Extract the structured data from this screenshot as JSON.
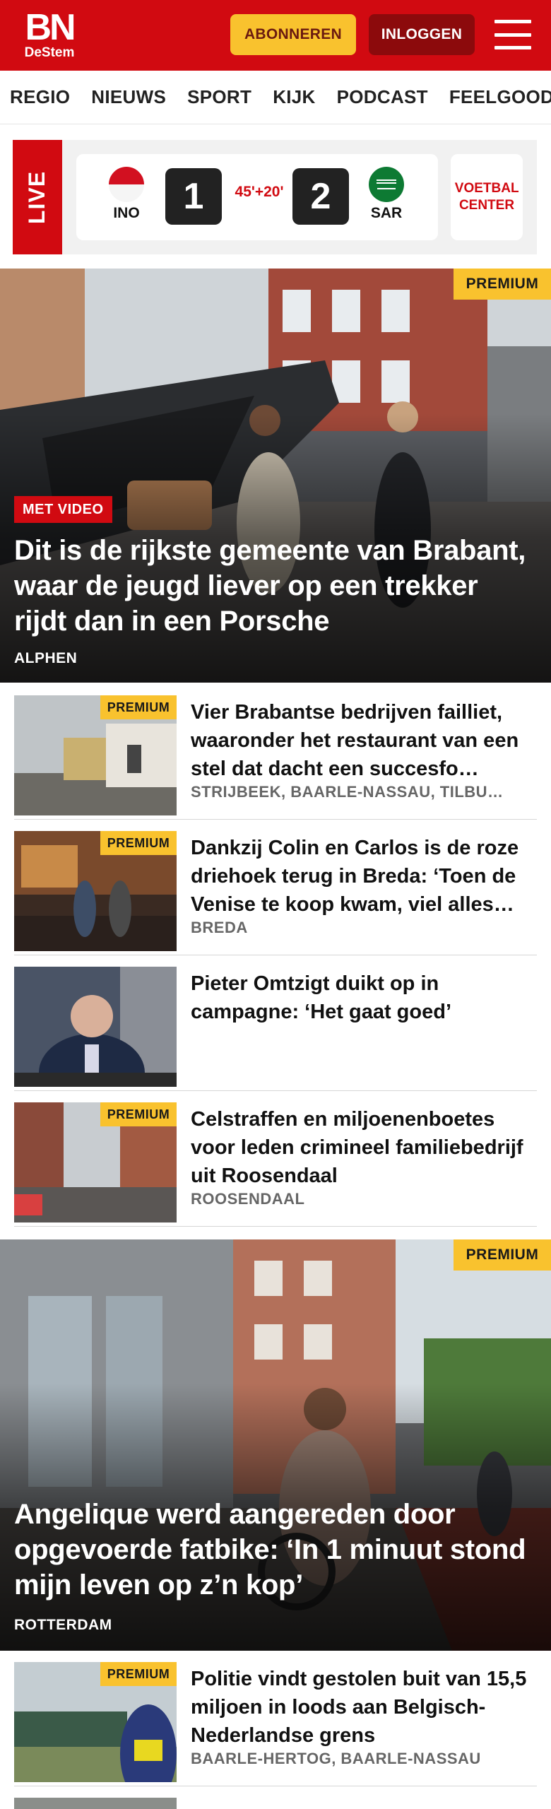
{
  "header": {
    "logo_main": "BN",
    "logo_sub": "DeStem",
    "subscribe_label": "ABONNEREN",
    "login_label": "INLOGGEN",
    "brand_color": "#d10a11",
    "accent_color": "#f9c22e"
  },
  "nav": {
    "items": [
      "REGIO",
      "NIEUWS",
      "SPORT",
      "KIJK",
      "PODCAST",
      "FEELGOOD"
    ]
  },
  "live": {
    "label": "LIVE",
    "home_team": "INO",
    "home_score": "1",
    "match_time": "45'+20'",
    "away_team": "SAR",
    "away_score": "2",
    "voetbal_label": "VOETBAL CENTER"
  },
  "premium_label": "PREMIUM",
  "hero1": {
    "badge": "MET VIDEO",
    "title": "Dit is de rijkste gemeente van Brabant, waar de jeugd liever op een trekker rijdt dan in een Porsche",
    "location": "ALPHEN",
    "premium": true
  },
  "articles": [
    {
      "premium": true,
      "title": "Vier Brabantse bedrijven failliet, waaronder het restaurant van een stel dat dacht een succesfo…",
      "location": "STRIJBEEK, BAARLE-NASSAU, TILBU…"
    },
    {
      "premium": true,
      "title": "Dankzij Colin en Carlos is de roze driehoek terug in Breda: ‘Toen de Venise te koop kwam, viel alles…",
      "location": "BREDA"
    },
    {
      "premium": false,
      "title": "Pieter Omtzigt duikt op in campagne: ‘Het gaat goed’",
      "location": ""
    },
    {
      "premium": true,
      "title": "Celstraffen en miljoenenboetes voor leden crimineel familiebe­drijf uit Roosendaal",
      "location": "ROOSENDAAL"
    }
  ],
  "hero2": {
    "title": "Angelique werd aangereden door opgevoerde fatbike: ‘In 1 minuut stond mijn leven op z’n kop’",
    "location": "ROTTERDAM",
    "premium": true
  },
  "articles2": [
    {
      "premium": true,
      "title": "Politie vindt gestolen buit van 15,5 miljoen in loods aan Bel­gisch-Nederlandse grens",
      "location": "BAARLE-HERTOG, BAARLE-NASSAU"
    }
  ]
}
